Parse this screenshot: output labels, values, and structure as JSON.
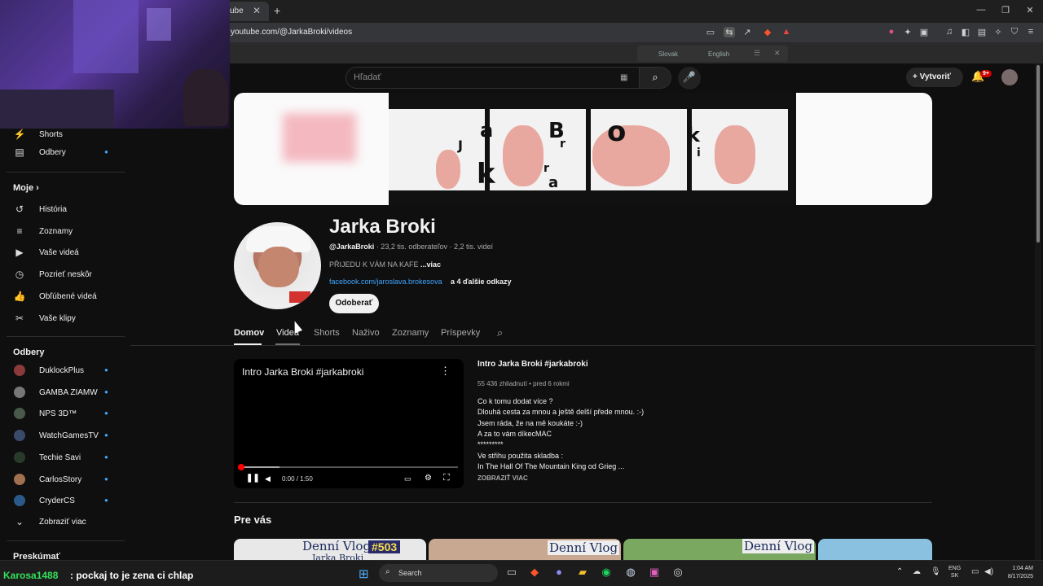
{
  "browser": {
    "tab_title": "ube",
    "tab_close": "✕",
    "new_tab": "+",
    "url": "youtube.com/@JarkaBroki/videos",
    "window_controls": [
      "—",
      "❐",
      "✕"
    ],
    "translate_bar": {
      "source": "Slovak",
      "target": "English",
      "menu": "☰",
      "close": "✕"
    }
  },
  "youtube_header": {
    "search_placeholder": "Hľadať",
    "search_icon": "⌕",
    "create_label": "Vytvoriť",
    "create_icon": "+",
    "notifications_badge": "9+",
    "bell_icon": "🔔"
  },
  "sidebar": {
    "top_items": [
      {
        "label": "Shorts",
        "icon": "shorts-icon",
        "glyph": "⚡"
      },
      {
        "label": "Odbery",
        "icon": "subscriptions-icon",
        "glyph": "▤"
      }
    ],
    "you_heading": "Moje",
    "you_chevron": "›",
    "you_items": [
      {
        "label": "História",
        "icon": "history-icon",
        "glyph": "↺"
      },
      {
        "label": "Zoznamy",
        "icon": "playlists-icon",
        "glyph": "≡"
      },
      {
        "label": "Vaše videá",
        "icon": "your-videos-icon",
        "glyph": "▶"
      },
      {
        "label": "Pozrieť neskôr",
        "icon": "watch-later-icon",
        "glyph": "◷"
      },
      {
        "label": "Obľúbené videá",
        "icon": "liked-videos-icon",
        "glyph": "👍"
      },
      {
        "label": "Vaše klipy",
        "icon": "clips-icon",
        "glyph": "✂"
      }
    ],
    "subs_heading": "Odbery",
    "subscriptions": [
      {
        "label": "DuklockPlus",
        "color": "#8a3a3a"
      },
      {
        "label": "GAMBA ZIAMW",
        "color": "#777777"
      },
      {
        "label": "NPS 3D™",
        "color": "#4a5a4a"
      },
      {
        "label": "WatchGamesTV",
        "color": "#3a4a6a"
      },
      {
        "label": "Techie Savi",
        "color": "#2a3a2a"
      },
      {
        "label": "CarlosStory",
        "color": "#a07050"
      },
      {
        "label": "CryderCS",
        "color": "#2a5a8a"
      }
    ],
    "show_more": "Zobraziť viac",
    "explore_heading": "Preskúmať"
  },
  "channel": {
    "name": "Jarka Broki",
    "handle": "@JarkaBroki",
    "stats": " · 23,2 tis. odberateľov · 2,2 tis. videí",
    "description": "PŘIJEDU K VÁM NA KAFE ",
    "description_more": "...viac",
    "link": "facebook.com/jaroslava.brokesova",
    "link_more": "a 4 ďalšie odkazy",
    "subscribe": "Odoberať",
    "tabs": [
      "Domov",
      "Videá",
      "Shorts",
      "Naživo",
      "Zoznamy",
      "Príspevky"
    ],
    "banner_letters": [
      "J",
      "a",
      "r",
      "B",
      "r",
      "k",
      "a",
      "o",
      "k",
      "i"
    ]
  },
  "featured": {
    "player_title": "Intro Jarka Broki #jarkabroki",
    "time": "0:00 / 1:50",
    "progress_fraction": 0.0,
    "buffer_fraction": 0.18,
    "title": "Intro Jarka Broki  #jarkabroki",
    "meta": "55 436 zhliadnutí • pred 6 rokmi",
    "description_lines": [
      "Co k tomu dodat více ?",
      "Dlouhá cesta za mnou a ještě delší přede mnou. :-)",
      "Jsem ráda, že na mě koukáte :-)",
      "A za to vám díkecMAC",
      "*********",
      "Ve střihu použita skladba :",
      "In The Hall Of The Mountain King od Grieg ..."
    ],
    "show_more": "ZOBRAZIŤ VIAC"
  },
  "for_you": {
    "heading": "Pre vás",
    "thumb_text": [
      "Denní Vlog",
      "Jarka Broki",
      "#503"
    ]
  },
  "taskbar": {
    "chat_user": "Karosa1488",
    "chat_message": ": pockaj to je zena ci chlap",
    "search_label": "Search",
    "lang_line1": "ENG",
    "lang_line2": "SK",
    "time": "1:04 AM",
    "date": "8/17/2025"
  }
}
